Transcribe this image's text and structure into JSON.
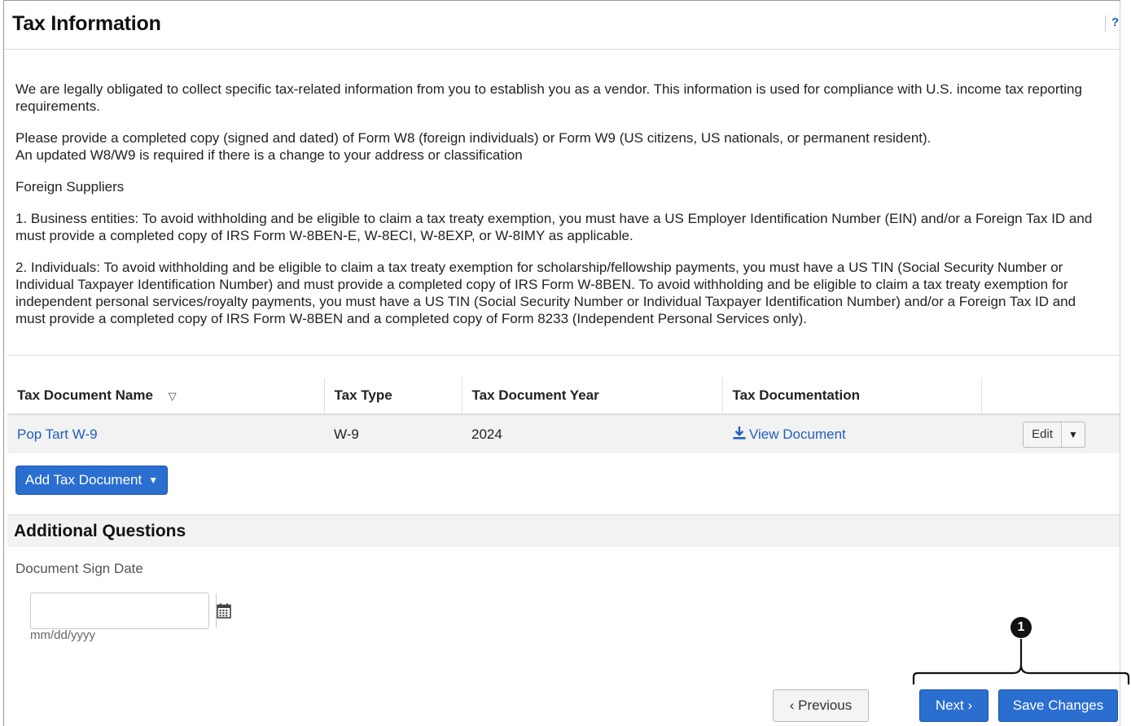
{
  "header": {
    "title": "Tax Information",
    "help_label": "?"
  },
  "intro": {
    "p1": "We are legally obligated to collect specific tax-related information from you to establish you as a vendor. This information is used for compliance with U.S. income tax reporting requirements.",
    "p2_line1": "Please provide a completed copy (signed and dated) of Form W8 (foreign individuals) or Form W9 (US citizens, US nationals, or permanent resident).",
    "p2_line2": "An updated W8/W9 is required if there is a change to your address or classification",
    "p3": "Foreign Suppliers",
    "p4": "1.   Business entities: To avoid withholding and be eligible to claim a tax treaty exemption, you must have a US Employer Identification Number (EIN) and/or a Foreign Tax ID and must provide a completed copy of IRS Form W-8BEN-E, W-8ECI, W-8EXP, or W-8IMY as applicable.",
    "p5": "2.   Individuals: To avoid withholding and be eligible to claim a tax treaty exemption for scholarship/fellowship payments, you must have a US TIN (Social Security Number or Individual Taxpayer Identification Number) and must provide a completed copy of IRS Form W-8BEN. To avoid withholding and be eligible to claim a tax treaty exemption for independent personal services/royalty payments, you must have a US TIN (Social Security Number or Individual Taxpayer Identification Number) and/or a Foreign Tax ID and must provide a completed copy of IRS Form W-8BEN and a completed copy of Form 8233 (Independent Personal Services only)."
  },
  "table": {
    "headers": {
      "name": "Tax Document Name",
      "type": "Tax Type",
      "year": "Tax Document Year",
      "doc": "Tax Documentation"
    },
    "rows": [
      {
        "name": "Pop Tart W-9",
        "type": "W-9",
        "year": "2024",
        "doc_link": "View Document",
        "edit_label": "Edit"
      }
    ]
  },
  "add_doc": {
    "label": "Add Tax Document"
  },
  "additional": {
    "title": "Additional Questions",
    "sign_date_label": "Document Sign Date",
    "sign_date_value": "",
    "sign_date_hint": "mm/dd/yyyy"
  },
  "footer": {
    "previous_label": "Previous",
    "next_label": "Next",
    "save_label": "Save Changes"
  },
  "callout": {
    "marker": "1"
  },
  "colors": {
    "primary_button": "#2a6ed0",
    "link": "#1f5fbf",
    "row_background": "#f2f2f2"
  },
  "icons": {
    "sort": "triangle-down-outline",
    "download": "download-arrow",
    "calendar": "calendar-grid",
    "caret": "caret-down"
  }
}
